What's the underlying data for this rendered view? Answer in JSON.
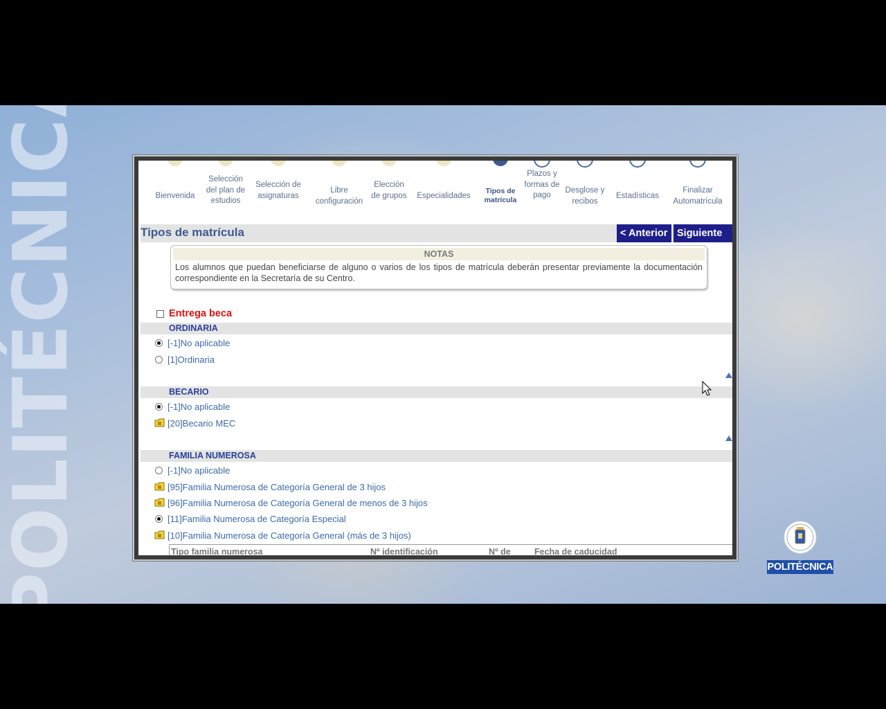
{
  "branding": {
    "watermark": "POLITÉCNICA",
    "logo_text": "POLITÉCNICA"
  },
  "steps": [
    {
      "label": "Bienvenida",
      "state": "done"
    },
    {
      "label": "Selección del plan de estudios",
      "state": "done"
    },
    {
      "label": "Selección de asignaturas",
      "state": "done"
    },
    {
      "label": "Libre configuración",
      "state": "done"
    },
    {
      "label": "Elección de grupos",
      "state": "done"
    },
    {
      "label": "Especialidades",
      "state": "done"
    },
    {
      "label": "Tipos de matrícula",
      "state": "current"
    },
    {
      "label": "Plazos y formas de pago",
      "state": "todo"
    },
    {
      "label": "Desglose y recibos",
      "state": "todo"
    },
    {
      "label": "Estadísticas",
      "state": "todo"
    },
    {
      "label": "Finalizar Automatrícula",
      "state": "todo"
    }
  ],
  "page": {
    "title": "Tipos de matrícula",
    "prev_label": "< Anterior",
    "next_label": "Siguiente >"
  },
  "notes": {
    "title": "NOTAS",
    "text": "Los alumnos que puedan beneficiarse de alguno o varios de los tipos de matrícula deberán presentar previamente la documentación correspondiente en la Secretaría de su Centro."
  },
  "entrega_beca": {
    "label": "Entrega beca",
    "checked": false
  },
  "sections": {
    "ordinaria": {
      "title": "ORDINARIA",
      "options": [
        {
          "text": "[-1]No aplicable",
          "control": "radio",
          "selected": true
        },
        {
          "text": "[1]Ordinaria",
          "control": "radio",
          "selected": false
        }
      ]
    },
    "becario": {
      "title": "BECARIO",
      "options": [
        {
          "text": "[-1]No aplicable",
          "control": "radio",
          "selected": true
        },
        {
          "text": "[20]Becario MEC",
          "control": "folder",
          "selected": false
        }
      ]
    },
    "familia": {
      "title": "FAMILIA NUMEROSA",
      "options": [
        {
          "text": "[-1]No aplicable",
          "control": "radio",
          "selected": false
        },
        {
          "text": "[95]Familia Numerosa de Categoría General de 3 hijos",
          "control": "folder",
          "selected": false
        },
        {
          "text": "[96]Familia Numerosa de Categoría General de menos de 3 hijos",
          "control": "folder",
          "selected": false
        },
        {
          "text": "[11]Familia Numerosa de Categoría Especial",
          "control": "radio",
          "selected": true
        },
        {
          "text": "[10]Familia Numerosa de Categoría General (más de 3 hijos)",
          "control": "folder",
          "selected": false
        }
      ]
    }
  },
  "family_table": {
    "columns": [
      "Tipo familia numerosa",
      "Nº identificación",
      "Nº de",
      "Fecha de caducidad"
    ]
  }
}
